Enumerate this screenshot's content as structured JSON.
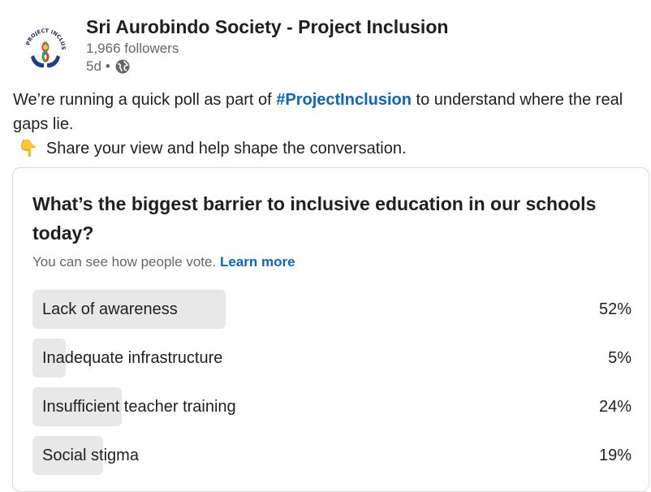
{
  "post": {
    "author": {
      "name": "Sri Aurobindo Society - Project Inclusion",
      "followers": "1,966 followers",
      "time": "5d",
      "separator": "•",
      "visibility_icon": "globe-icon",
      "logo_text": "PROJECT INCLUSION"
    },
    "text": {
      "line1_before": "We’re running a quick poll as part of ",
      "hashtag": "#ProjectInclusion",
      "line1_after": " to understand where the real gaps lie.",
      "emoji": "👇",
      "line2": "Share your view and help shape the conversation."
    }
  },
  "poll": {
    "question": "What’s the biggest barrier to inclusive education in our schools today?",
    "subtitle": "You can see how people vote.",
    "learn_more": "Learn more",
    "options": [
      {
        "label": "Lack of awareness",
        "percent_text": "52%",
        "percent": 52
      },
      {
        "label": "Inadequate infrastructure",
        "percent_text": "5%",
        "percent": 5
      },
      {
        "label": "Insufficient teacher training",
        "percent_text": "24%",
        "percent": 24
      },
      {
        "label": "Social stigma",
        "percent_text": "19%",
        "percent": 19
      }
    ]
  },
  "colors": {
    "link": "#0a66c2",
    "bar": "#e8e8e8",
    "muted": "#666666",
    "text": "#1f1f1f"
  }
}
